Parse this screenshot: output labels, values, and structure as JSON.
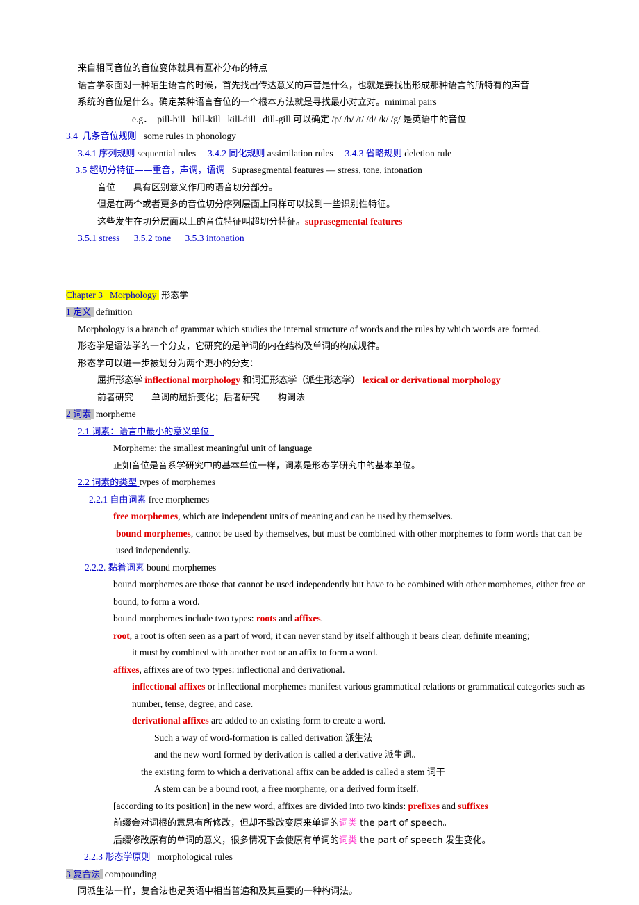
{
  "document": {
    "title": "Linguistics study notes — Phonology / Morphology",
    "colors": {
      "heading_blue": "#0000c8",
      "term_red": "#e00000",
      "accent_pink": "#ff33cc",
      "highlight_yellow": "#ffff00",
      "highlight_gray": "#c0c0c0"
    }
  },
  "phonology": {
    "line1": "来自相同音位的音位变体就具有互补分布的特点",
    "line2a": "语言学家面对一种陌生语言的时候，首先找出传达意义的声音是什么，也就是要找出形成那种语言的所特有的声音",
    "line2b": "系统的音位是什么。确定某种语言音位的一个根本方法就是寻找最小对立对。",
    "line2b_en": "minimal pairs",
    "eg_label": "e.g．",
    "eg_pairs": "pill-bill   bill-kill   kill-dill   dill-gill",
    "eg_tail_cn1": "可以确定",
    "eg_symbols": "/p/ /b/ /t/ /d/ /k/ /g/",
    "eg_tail_cn2": "是英语中的音位",
    "s34_num": "3.4",
    "s34_cn": "几条音位规则",
    "s34_en": "some rules in phonology",
    "s341_num": "3.4.1",
    "s341_cn": "序列规则",
    "s341_en": "sequential rules",
    "s342_num": "3.4.2",
    "s342_cn": "同化规则",
    "s342_en": "assimilation rules",
    "s343_num": "3.4.3",
    "s343_cn": "省略规则",
    "s343_en": "deletion rule",
    "s35_num": "3.5",
    "s35_cn": "超切分特征——重音，声调，语调",
    "s35_en": "Suprasegmental features — stress, tone, intonation",
    "s35_body1": "音位——具有区别意义作用的语音切分部分。",
    "s35_body2": "但是在两个或者更多的音位切分序列层面上同样可以找到一些识别性特征。",
    "s35_body3": "这些发生在切分层面以上的音位特征叫超切分特征。",
    "s35_body3_term": "suprasegmental features",
    "s351": "3.5.1 stress",
    "s352": "3.5.2 tone",
    "s353": "3.5.3 intonation"
  },
  "chapter3": {
    "chapter_label": "Chapter 3",
    "chapter_en": "Morphology",
    "chapter_cn": "形态学",
    "sec1_num": "1",
    "sec1_cn": "定义",
    "sec1_en": "definition",
    "def_en": "Morphology is a branch of grammar which studies the internal structure of words and the rules by which words are formed.",
    "def_cn1": "形态学是语法学的一个分支，它研究的是单词的内在结构及单词的构成规律。",
    "def_cn2": "形态学可以进一步被划分为两个更小的分支：",
    "branch_cn1": "屈折形态学",
    "branch_term1": "inflectional morphology",
    "branch_cn2": "和词汇形态学（派生形态学）",
    "branch_term2": "lexical or derivational morphology",
    "branch_cn3": "前者研究——单词的屈折变化；后者研究——构词法",
    "sec2_num": "2",
    "sec2_cn": "词素",
    "sec2_en": "morpheme",
    "sec21_num": "2.1",
    "sec21_cn": "词素：语言中最小的意义单位",
    "sec21_body_en": "Morpheme: the smallest meaningful unit of language",
    "sec21_body_cn": "正如音位是音系学研究中的基本单位一样，词素是形态学研究中的基本单位。",
    "sec22_num": "2.2",
    "sec22_cn": "词素的类型",
    "sec22_en": "types of morphemes",
    "sec221_num": "2.2.1",
    "sec221_cn": "自由词素",
    "sec221_en": "free morphemes",
    "free_term": "free morphemes",
    "free_body": ", which are independent units of meaning and can be used by themselves.",
    "bound_term": "bound morphemes",
    "bound_body": ", cannot be used by themselves, but must be combined with other morphemes to form words that can be used independently.",
    "sec222_num": "2.2.2.",
    "sec222_cn": "黏着词素",
    "sec222_en": "bound morphemes",
    "bm_body1": "bound morphemes are those that cannot be used independently but have to be combined with other morphemes, either free or bound, to form a word.",
    "bm_types_pre": "bound morphemes include two types: ",
    "bm_types_roots": "roots",
    "bm_types_mid": " and ",
    "bm_types_affixes": "affixes",
    "bm_types_end": ".",
    "root_term": "root",
    "root_body": ", a root is often seen as a part of word; it can never stand by itself although it bears clear, definite meaning;",
    "root_body2": "it must by combined with another root or an affix to form a word.",
    "affixes_term": "affixes",
    "affixes_body": ", affixes are of two types: inflectional and derivational.",
    "infl_term": "inflectional affixes",
    "infl_body": " or inflectional morphemes manifest various grammatical relations or grammatical categories such as number, tense, degree, and case.",
    "deriv_term": "derivational affixes",
    "deriv_body": " are added to an existing form to create a word.",
    "deriv_l1_en": "Such a way of word-formation is called derivation ",
    "deriv_l1_cn": "派生法",
    "deriv_l2_en": "and the new word formed by derivation is called a derivative ",
    "deriv_l2_cn": "派生词。",
    "stem_en": "the existing form to which a derivational affix can be added is called a stem ",
    "stem_cn": "词干",
    "stem_body": "A stem can be a bound root, a free morpheme, or a derived form itself.",
    "pos_pre": "[according to its position] in the new word, affixes are divided into two kinds: ",
    "pos_prefixes": "prefixes",
    "pos_mid": " and ",
    "pos_suffixes": "suffixes",
    "prefix_cn1": "前缀会对词根的意思有所修改，但却不致改变原来单词的",
    "prefix_cikind": "词类",
    "prefix_cn2": " the part of speech。",
    "suffix_cn1": "后缀修改原有的单词的意义，很多情况下会使原有单词的",
    "suffix_cikind": "词类",
    "suffix_cn2": " the part of speech 发生变化。",
    "sec223_num": "2.2.3",
    "sec223_cn": "形态学原则",
    "sec223_en": "morphological rules",
    "sec3_num": "3",
    "sec3_cn": "复合法",
    "sec3_en": "compounding",
    "sec3_body": "同派生法一样，复合法也是英语中相当普遍和及其重要的一种构词法。"
  }
}
